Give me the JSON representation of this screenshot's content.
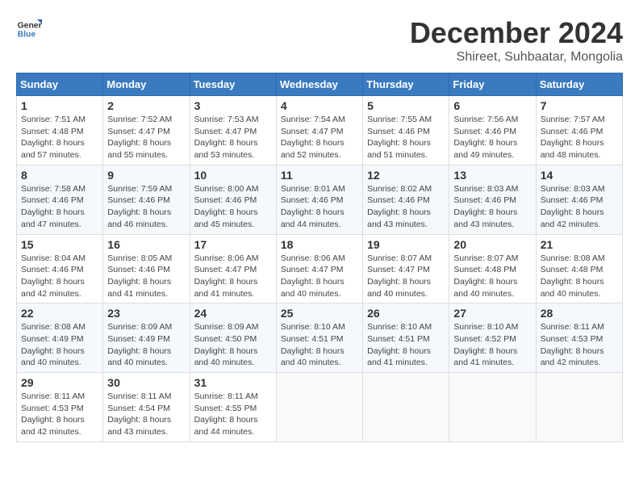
{
  "logo": {
    "text_general": "General",
    "text_blue": "Blue"
  },
  "title": {
    "month": "December 2024",
    "location": "Shireet, Suhbaatar, Mongolia"
  },
  "weekdays": [
    "Sunday",
    "Monday",
    "Tuesday",
    "Wednesday",
    "Thursday",
    "Friday",
    "Saturday"
  ],
  "weeks": [
    [
      {
        "day": "1",
        "sunrise": "7:51 AM",
        "sunset": "4:48 PM",
        "daylight": "8 hours and 57 minutes."
      },
      {
        "day": "2",
        "sunrise": "7:52 AM",
        "sunset": "4:47 PM",
        "daylight": "8 hours and 55 minutes."
      },
      {
        "day": "3",
        "sunrise": "7:53 AM",
        "sunset": "4:47 PM",
        "daylight": "8 hours and 53 minutes."
      },
      {
        "day": "4",
        "sunrise": "7:54 AM",
        "sunset": "4:47 PM",
        "daylight": "8 hours and 52 minutes."
      },
      {
        "day": "5",
        "sunrise": "7:55 AM",
        "sunset": "4:46 PM",
        "daylight": "8 hours and 51 minutes."
      },
      {
        "day": "6",
        "sunrise": "7:56 AM",
        "sunset": "4:46 PM",
        "daylight": "8 hours and 49 minutes."
      },
      {
        "day": "7",
        "sunrise": "7:57 AM",
        "sunset": "4:46 PM",
        "daylight": "8 hours and 48 minutes."
      }
    ],
    [
      {
        "day": "8",
        "sunrise": "7:58 AM",
        "sunset": "4:46 PM",
        "daylight": "8 hours and 47 minutes."
      },
      {
        "day": "9",
        "sunrise": "7:59 AM",
        "sunset": "4:46 PM",
        "daylight": "8 hours and 46 minutes."
      },
      {
        "day": "10",
        "sunrise": "8:00 AM",
        "sunset": "4:46 PM",
        "daylight": "8 hours and 45 minutes."
      },
      {
        "day": "11",
        "sunrise": "8:01 AM",
        "sunset": "4:46 PM",
        "daylight": "8 hours and 44 minutes."
      },
      {
        "day": "12",
        "sunrise": "8:02 AM",
        "sunset": "4:46 PM",
        "daylight": "8 hours and 43 minutes."
      },
      {
        "day": "13",
        "sunrise": "8:03 AM",
        "sunset": "4:46 PM",
        "daylight": "8 hours and 43 minutes."
      },
      {
        "day": "14",
        "sunrise": "8:03 AM",
        "sunset": "4:46 PM",
        "daylight": "8 hours and 42 minutes."
      }
    ],
    [
      {
        "day": "15",
        "sunrise": "8:04 AM",
        "sunset": "4:46 PM",
        "daylight": "8 hours and 42 minutes."
      },
      {
        "day": "16",
        "sunrise": "8:05 AM",
        "sunset": "4:46 PM",
        "daylight": "8 hours and 41 minutes."
      },
      {
        "day": "17",
        "sunrise": "8:06 AM",
        "sunset": "4:47 PM",
        "daylight": "8 hours and 41 minutes."
      },
      {
        "day": "18",
        "sunrise": "8:06 AM",
        "sunset": "4:47 PM",
        "daylight": "8 hours and 40 minutes."
      },
      {
        "day": "19",
        "sunrise": "8:07 AM",
        "sunset": "4:47 PM",
        "daylight": "8 hours and 40 minutes."
      },
      {
        "day": "20",
        "sunrise": "8:07 AM",
        "sunset": "4:48 PM",
        "daylight": "8 hours and 40 minutes."
      },
      {
        "day": "21",
        "sunrise": "8:08 AM",
        "sunset": "4:48 PM",
        "daylight": "8 hours and 40 minutes."
      }
    ],
    [
      {
        "day": "22",
        "sunrise": "8:08 AM",
        "sunset": "4:49 PM",
        "daylight": "8 hours and 40 minutes."
      },
      {
        "day": "23",
        "sunrise": "8:09 AM",
        "sunset": "4:49 PM",
        "daylight": "8 hours and 40 minutes."
      },
      {
        "day": "24",
        "sunrise": "8:09 AM",
        "sunset": "4:50 PM",
        "daylight": "8 hours and 40 minutes."
      },
      {
        "day": "25",
        "sunrise": "8:10 AM",
        "sunset": "4:51 PM",
        "daylight": "8 hours and 40 minutes."
      },
      {
        "day": "26",
        "sunrise": "8:10 AM",
        "sunset": "4:51 PM",
        "daylight": "8 hours and 41 minutes."
      },
      {
        "day": "27",
        "sunrise": "8:10 AM",
        "sunset": "4:52 PM",
        "daylight": "8 hours and 41 minutes."
      },
      {
        "day": "28",
        "sunrise": "8:11 AM",
        "sunset": "4:53 PM",
        "daylight": "8 hours and 42 minutes."
      }
    ],
    [
      {
        "day": "29",
        "sunrise": "8:11 AM",
        "sunset": "4:53 PM",
        "daylight": "8 hours and 42 minutes."
      },
      {
        "day": "30",
        "sunrise": "8:11 AM",
        "sunset": "4:54 PM",
        "daylight": "8 hours and 43 minutes."
      },
      {
        "day": "31",
        "sunrise": "8:11 AM",
        "sunset": "4:55 PM",
        "daylight": "8 hours and 44 minutes."
      },
      null,
      null,
      null,
      null
    ]
  ]
}
